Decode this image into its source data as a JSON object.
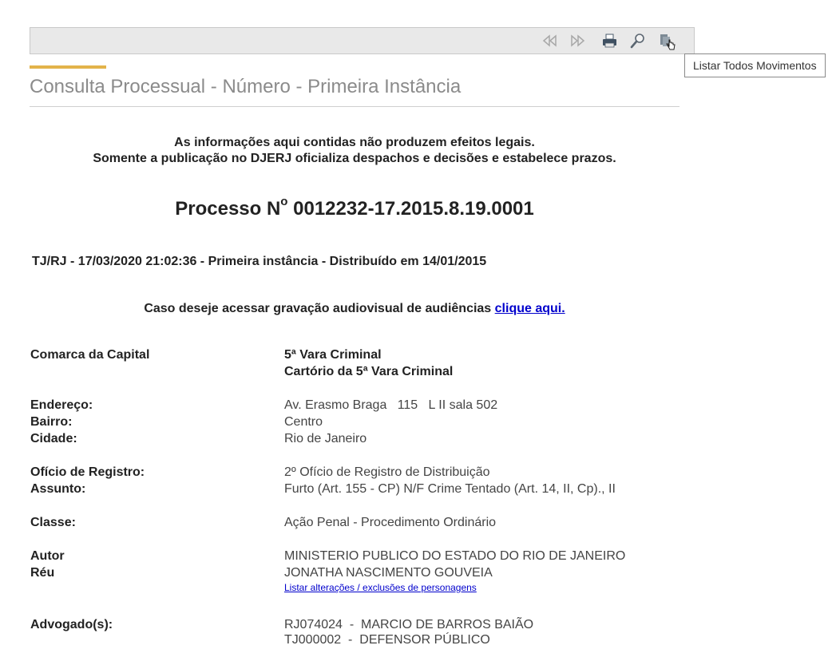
{
  "toolbar": {
    "icons": [
      "first-page-icon",
      "next-page-icon",
      "print-icon",
      "search-icon",
      "list-movements-icon"
    ],
    "tooltip": "Listar Todos Movimentos"
  },
  "header": {
    "title": "Consulta Processual - Número - Primeira Instância"
  },
  "notice": {
    "line1": "As informações aqui contidas não produzem efeitos legais.",
    "line2": "Somente a publicação no DJERJ oficializa despachos e decisões e estabelece prazos."
  },
  "processo": {
    "prefix": "Processo N",
    "sup": "o",
    "number": " 0012232-17.2015.8.19.0001"
  },
  "infoline": "TJ/RJ - 17/03/2020 21:02:36 - Primeira instância - Distribuído em 14/01/2015",
  "audio": {
    "text": "Caso deseje acessar gravação audiovisual de audiências ",
    "link": "clique aqui."
  },
  "details": {
    "comarca_label": "Comarca da Capital",
    "vara": "5ª Vara Criminal",
    "cartorio": "Cartório da 5ª Vara Criminal",
    "endereco_label": "Endereço:",
    "endereco": "Av. Erasmo Braga   115   L II sala 502",
    "bairro_label": "Bairro:",
    "bairro": "Centro",
    "cidade_label": "Cidade:",
    "cidade": "Rio de Janeiro",
    "oficio_label": "Ofício de Registro:",
    "oficio": "2º Ofício de Registro de Distribuição",
    "assunto_label": "Assunto:",
    "assunto": "Furto (Art. 155 - CP) N/F Crime Tentado (Art. 14, II, Cp)., II",
    "classe_label": "Classe:",
    "classe": "Ação Penal - Procedimento Ordinário",
    "autor_label": "Autor",
    "autor": "MINISTERIO PUBLICO DO ESTADO DO RIO DE JANEIRO",
    "reu_label": "Réu",
    "reu": "JONATHA NASCIMENTO GOUVEIA",
    "alteracoes_link": "Listar alterações / exclusões de personagens",
    "advogados_label": "Advogado(s):",
    "advogado1": "RJ074024  -  MARCIO DE BARROS BAIÃO",
    "advogado2": "TJ000002  -  DEFENSOR PÚBLICO"
  }
}
